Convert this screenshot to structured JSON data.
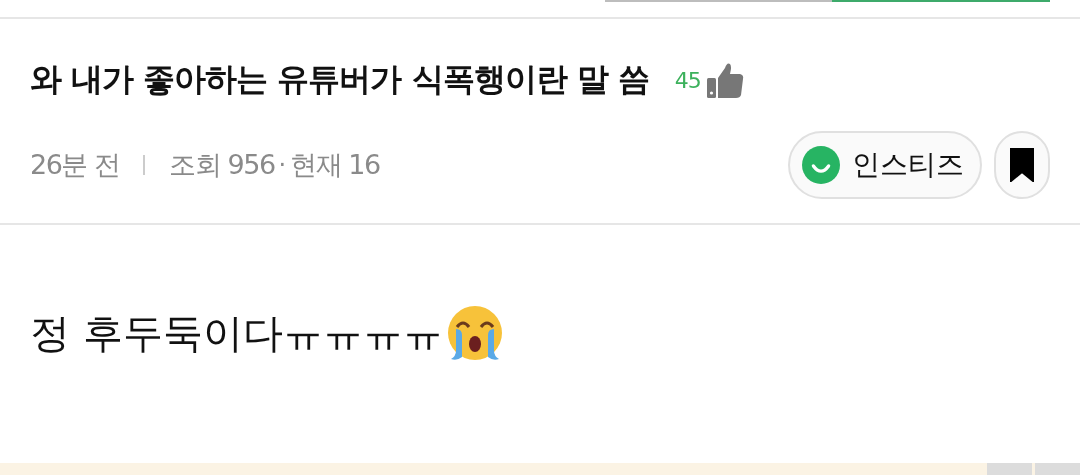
{
  "top_indicator": {
    "level": 0.49
  },
  "post": {
    "title": "와 내가 좋아하는 유튜버가 식폭행이란 말 씀",
    "likes": "45",
    "time": "26분 전",
    "views": "조회 956",
    "separator": "·",
    "current": "현재 16",
    "community": "인스티즈",
    "bookmarked": true,
    "body": "정 후두둑이다ㅠㅠㅠㅠ"
  }
}
